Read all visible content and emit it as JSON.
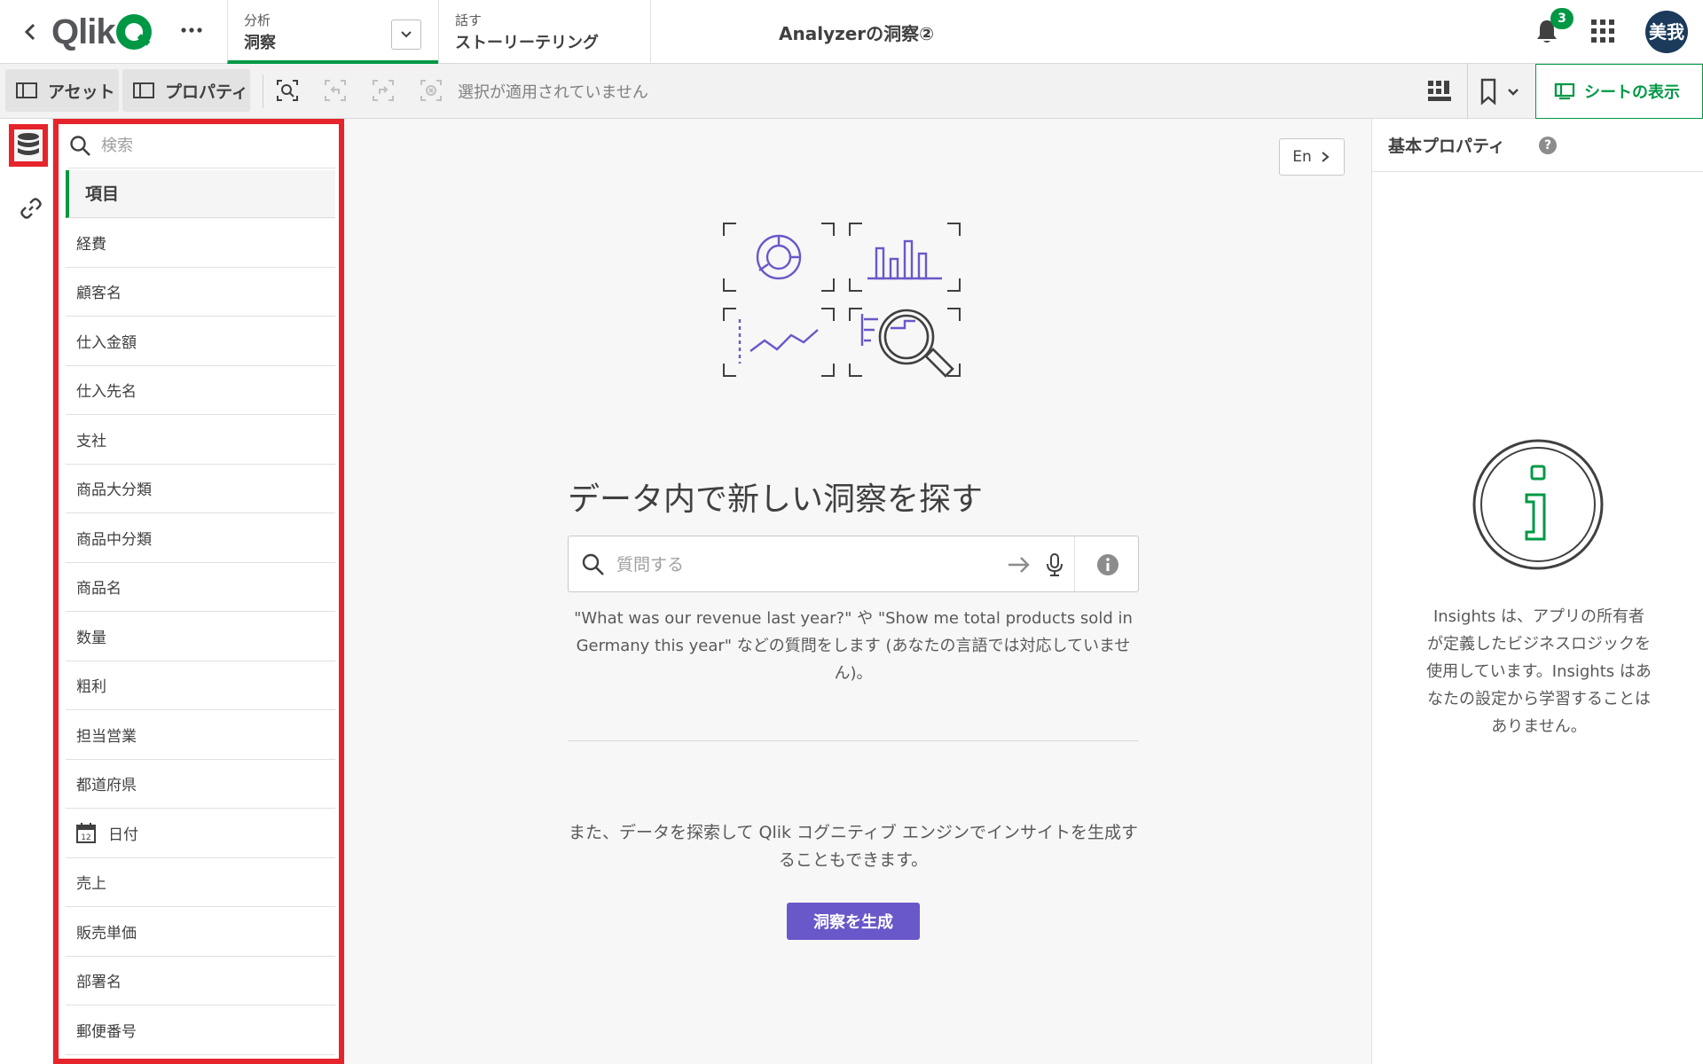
{
  "topbar": {
    "logo_text": "Qlik",
    "tab_analyze": {
      "small": "分析",
      "big": "洞察"
    },
    "tab_narrate": {
      "small": "話す",
      "big": "ストーリーテリング"
    },
    "app_title": "Analyzerの洞察②",
    "notification_count": "3",
    "avatar_initials": "美我",
    "brand_color": "#009845"
  },
  "toolbar": {
    "assets_label": "アセット",
    "properties_label": "プロパティ",
    "no_selection_text": "選択が適用されていません",
    "sheet_button_label": "シートの表示"
  },
  "fields": {
    "search_placeholder": "検索",
    "header": "項目",
    "items": [
      {
        "label": "経費"
      },
      {
        "label": "顧客名"
      },
      {
        "label": "仕入金額"
      },
      {
        "label": "仕入先名"
      },
      {
        "label": "支社"
      },
      {
        "label": "商品大分類"
      },
      {
        "label": "商品中分類"
      },
      {
        "label": "商品名"
      },
      {
        "label": "数量"
      },
      {
        "label": "粗利"
      },
      {
        "label": "担当営業"
      },
      {
        "label": "都道府県"
      },
      {
        "label": "日付",
        "icon": "calendar-icon"
      },
      {
        "label": "売上"
      },
      {
        "label": "販売単価"
      },
      {
        "label": "部署名"
      },
      {
        "label": "郵便番号"
      }
    ],
    "highlight_color": "#e5242b"
  },
  "main": {
    "language_button": "En",
    "title": "データ内で新しい洞察を探す",
    "ask_placeholder": "質問する",
    "hint_text": "\"What was our revenue last year?\" や \"Show me total products sold in Germany this year\" などの質問をします (あなたの言語では対応していません)。",
    "cognitive_text": "また、データを探索して Qlik コグニティブ エンジンでインサイトを生成することもできます。",
    "generate_button": "洞察を生成",
    "accent_color": "#6958c9"
  },
  "properties": {
    "title": "基本プロパティ",
    "help": "?",
    "info_text": "Insights は、アプリの所有者が定義したビジネスロジックを使用しています。Insights はあなたの設定から学習することはありません。"
  }
}
